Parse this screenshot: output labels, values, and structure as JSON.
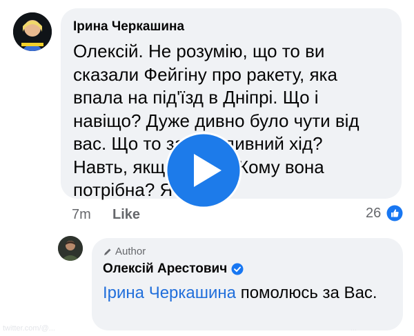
{
  "comment": {
    "author": "Ірина Черкашина",
    "text": "Олексій. Не розумію, що то ви\nсказали Фейгіну про ракету, яка\nвпала на під'їзд в Дніпрі. Що і\nнавіщо? Дуже дивно було чути від\nвас. Що то за ... й дивний хід?\nНавть, якщо ... зда. Кому вона\nпотрібна? Я",
    "time": "7m",
    "like_label": "Like",
    "reaction_count": "26"
  },
  "reply": {
    "badge": "Author",
    "author": "Олексій Арестович",
    "mention": "Ірина Черкашина",
    "text": " помолюсь за Вас."
  },
  "watermark": {
    "left": "twitter.com/@...",
    "right": "..."
  },
  "colors": {
    "bubble": "#f0f2f5",
    "accent": "#1877f2",
    "mention": "#216fdb",
    "meta": "#65676b"
  }
}
